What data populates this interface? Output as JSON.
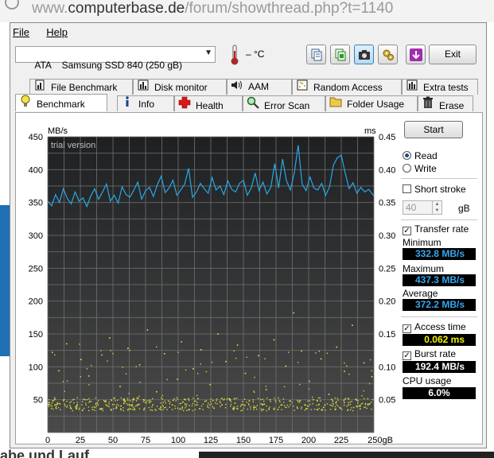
{
  "browser": {
    "url_prefix": "www.",
    "url_domain": "computerbase.de",
    "url_path": "/forum/showthread.php?t=1140",
    "bg_bottom_text": "abe und Lauf"
  },
  "menu": {
    "file": "File",
    "help": "Help"
  },
  "toolbar": {
    "drive_bus": "ATA",
    "drive_name": "Samsung SSD 840 (250 gB)",
    "temperature": "– °C",
    "exit_label": "Exit"
  },
  "tabs_top": [
    {
      "label": "File Benchmark",
      "icon": "file-benchmark-icon"
    },
    {
      "label": "Disk monitor",
      "icon": "disk-monitor-icon"
    },
    {
      "label": "AAM",
      "icon": "speaker-icon"
    },
    {
      "label": "Random Access",
      "icon": "random-access-icon"
    },
    {
      "label": "Extra tests",
      "icon": "extra-tests-icon"
    }
  ],
  "tabs_bottom": [
    {
      "label": "Benchmark",
      "icon": "lightbulb-icon"
    },
    {
      "label": "Info",
      "icon": "info-icon"
    },
    {
      "label": "Health",
      "icon": "red-cross-icon"
    },
    {
      "label": "Error Scan",
      "icon": "magnifier-icon"
    },
    {
      "label": "Folder Usage",
      "icon": "folder-icon"
    },
    {
      "label": "Erase",
      "icon": "trash-icon"
    }
  ],
  "controls": {
    "start_label": "Start",
    "read_label": "Read",
    "write_label": "Write",
    "mode_selected": "Read",
    "short_stroke_label": "Short stroke",
    "short_stroke_checked": false,
    "short_stroke_value": "40",
    "short_stroke_unit": "gB",
    "transfer_rate_label": "Transfer rate",
    "transfer_rate_checked": true,
    "minimum_label": "Minimum",
    "minimum_value": "332.8 MB/s",
    "maximum_label": "Maximum",
    "maximum_value": "437.3 MB/s",
    "average_label": "Average",
    "average_value": "372.2 MB/s",
    "access_time_label": "Access time",
    "access_time_checked": true,
    "access_time_value": "0.062 ms",
    "burst_rate_label": "Burst rate",
    "burst_rate_checked": true,
    "burst_rate_value": "192.4 MB/s",
    "cpu_usage_label": "CPU usage",
    "cpu_usage_value": "6.0%"
  },
  "colors": {
    "chart_bg": "#2b2b2b",
    "grid": "#707070",
    "transfer_line": "#2aa7e6",
    "access_dots": "#e6e63a",
    "value_blue": "#35a9ef",
    "value_yellow": "#f3f300"
  },
  "chart_data": {
    "type": "line",
    "watermark": "trial version",
    "y_left_unit": "MB/s",
    "y_right_unit": "ms",
    "x_unit": "gB",
    "x_ticks": [
      "0",
      "25",
      "50",
      "75",
      "100",
      "125",
      "150",
      "175",
      "200",
      "225",
      "250gB"
    ],
    "y_left_ticks": [
      "450",
      "400",
      "350",
      "300",
      "250",
      "200",
      "150",
      "100",
      "50"
    ],
    "y_right_ticks": [
      "0.45",
      "0.40",
      "0.35",
      "0.30",
      "0.25",
      "0.20",
      "0.15",
      "0.10",
      "0.05"
    ],
    "xlim": [
      0,
      250
    ],
    "ylim": [
      0,
      450
    ],
    "y2lim": [
      0,
      0.45
    ],
    "series": [
      {
        "name": "Transfer rate",
        "x": [
          0,
          3,
          6,
          9,
          12,
          15,
          18,
          21,
          24,
          27,
          30,
          33,
          36,
          39,
          42,
          45,
          48,
          51,
          54,
          57,
          60,
          63,
          66,
          69,
          72,
          75,
          78,
          81,
          84,
          87,
          90,
          93,
          96,
          99,
          102,
          105,
          108,
          111,
          114,
          117,
          120,
          123,
          126,
          129,
          132,
          135,
          138,
          141,
          144,
          147,
          150,
          153,
          156,
          159,
          162,
          165,
          168,
          171,
          174,
          177,
          180,
          183,
          186,
          189,
          192,
          195,
          198,
          201,
          204,
          207,
          210,
          213,
          216,
          219,
          222,
          225,
          228,
          231,
          234,
          237,
          240,
          243,
          246,
          250
        ],
        "values": [
          352,
          345,
          362,
          350,
          371,
          356,
          348,
          366,
          352,
          357,
          344,
          360,
          371,
          355,
          366,
          378,
          352,
          361,
          349,
          374,
          362,
          358,
          369,
          381,
          355,
          368,
          373,
          359,
          377,
          390,
          365,
          372,
          384,
          361,
          369,
          378,
          402,
          358,
          366,
          379,
          371,
          364,
          388,
          369,
          375,
          362,
          383,
          370,
          366,
          379,
          384,
          361,
          372,
          395,
          368,
          381,
          363,
          373,
          409,
          372,
          416,
          383,
          369,
          395,
          437,
          378,
          368,
          389,
          372,
          369,
          379,
          361,
          374,
          407,
          418,
          422,
          395,
          371,
          380,
          364,
          373,
          366,
          370,
          360
        ]
      },
      {
        "name": "Access time",
        "unit": "ms",
        "x": [
          3,
          5,
          8,
          12,
          14,
          17,
          22,
          25,
          28,
          31,
          34,
          38,
          41,
          44,
          47,
          52,
          55,
          58,
          61,
          64,
          66,
          70,
          73,
          76,
          80,
          83,
          86,
          89,
          92,
          95,
          99,
          102,
          105,
          108,
          111,
          114,
          117,
          121,
          124,
          127,
          130,
          133,
          136,
          139,
          142,
          145,
          148,
          151,
          154,
          158,
          161,
          164,
          167,
          170,
          173,
          176,
          179,
          182,
          185,
          188,
          191,
          194,
          197,
          200,
          203,
          206,
          209,
          212,
          215,
          218,
          221,
          224,
          227,
          230,
          233,
          236,
          239,
          242,
          245,
          248
        ],
        "values": [
          0.123,
          0.043,
          0.095,
          0.051,
          0.136,
          0.038,
          0.043,
          0.112,
          0.051,
          0.087,
          0.036,
          0.043,
          0.119,
          0.049,
          0.145,
          0.038,
          0.071,
          0.052,
          0.129,
          0.043,
          0.037,
          0.104,
          0.051,
          0.157,
          0.043,
          0.063,
          0.036,
          0.121,
          0.049,
          0.043,
          0.082,
          0.139,
          0.051,
          0.036,
          0.098,
          0.043,
          0.127,
          0.049,
          0.074,
          0.038,
          0.151,
          0.043,
          0.109,
          0.052,
          0.036,
          0.134,
          0.043,
          0.091,
          0.049,
          0.039,
          0.118,
          0.043,
          0.066,
          0.051,
          0.142,
          0.036,
          0.043,
          0.102,
          0.049,
          0.183,
          0.038,
          0.125,
          0.043,
          0.079,
          0.051,
          0.036,
          0.113,
          0.043,
          0.059,
          0.049,
          0.131,
          0.038,
          0.094,
          0.043,
          0.164,
          0.051,
          0.037,
          0.107,
          0.043,
          0.086
        ]
      }
    ]
  }
}
